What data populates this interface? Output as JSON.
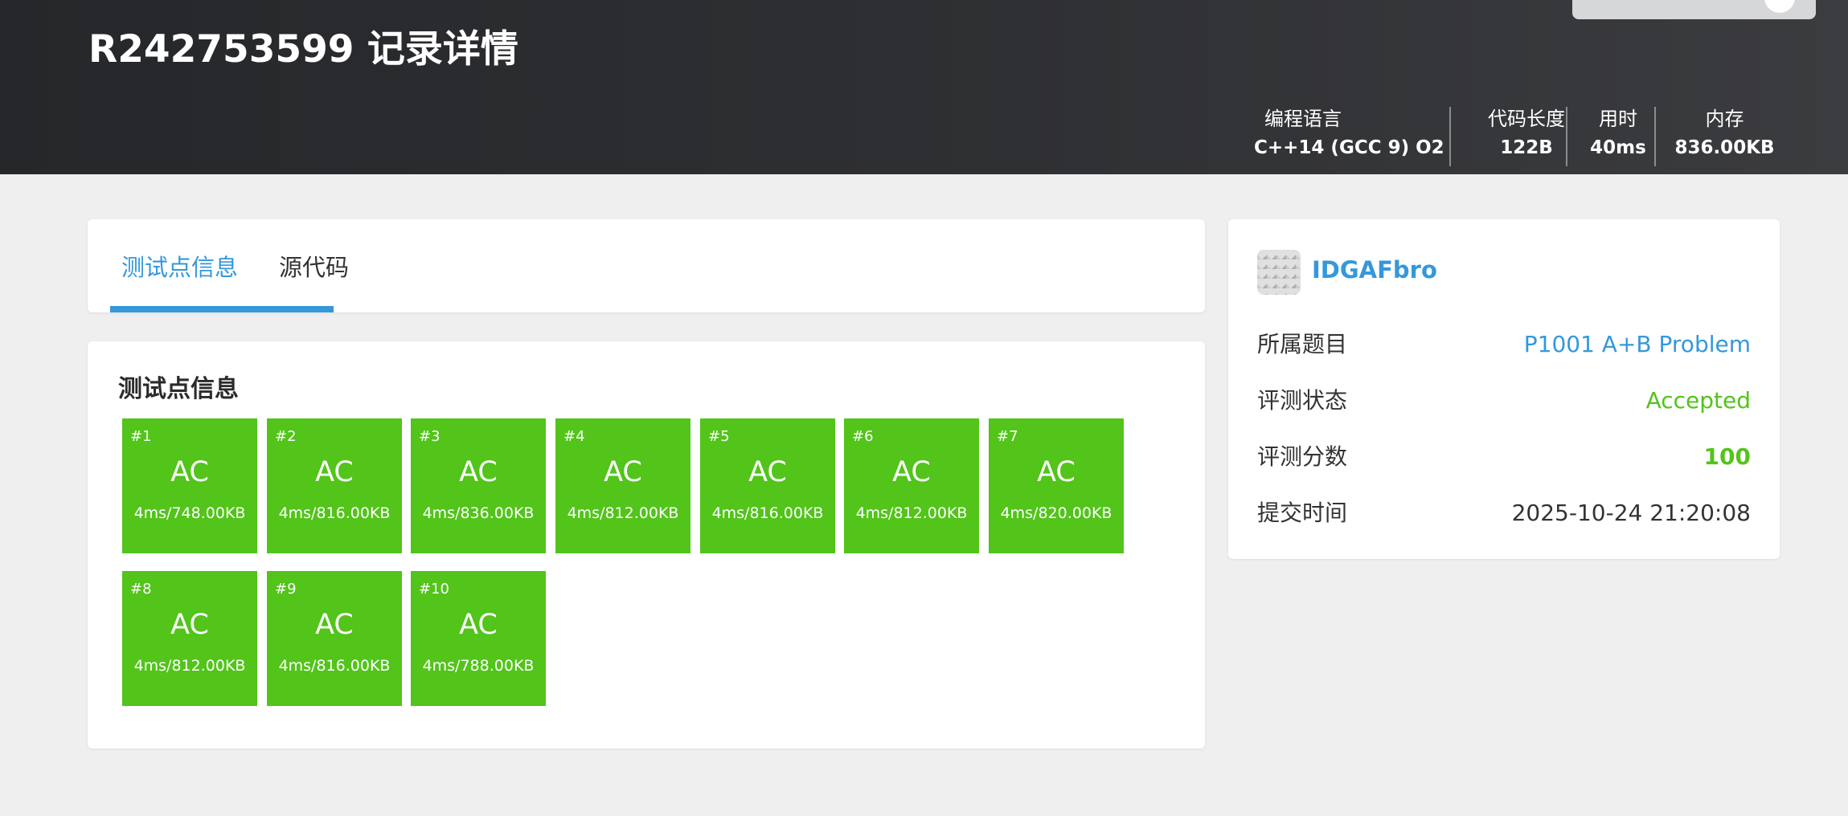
{
  "header": {
    "title": "R242753599 记录详情",
    "stats": [
      {
        "label": "编程语言",
        "value": "C++14 (GCC 9) O2"
      },
      {
        "label": "代码长度",
        "value": "122B"
      },
      {
        "label": "用时",
        "value": "40ms"
      },
      {
        "label": "内存",
        "value": "836.00KB"
      }
    ]
  },
  "tabs": [
    {
      "label": "测试点信息",
      "active": true
    },
    {
      "label": "源代码",
      "active": false
    }
  ],
  "tests": {
    "title": "测试点信息",
    "color": "#52c41a",
    "cases": [
      {
        "id": "#1",
        "status": "AC",
        "detail": "4ms/748.00KB"
      },
      {
        "id": "#2",
        "status": "AC",
        "detail": "4ms/816.00KB"
      },
      {
        "id": "#3",
        "status": "AC",
        "detail": "4ms/836.00KB"
      },
      {
        "id": "#4",
        "status": "AC",
        "detail": "4ms/812.00KB"
      },
      {
        "id": "#5",
        "status": "AC",
        "detail": "4ms/816.00KB"
      },
      {
        "id": "#6",
        "status": "AC",
        "detail": "4ms/812.00KB"
      },
      {
        "id": "#7",
        "status": "AC",
        "detail": "4ms/820.00KB"
      },
      {
        "id": "#8",
        "status": "AC",
        "detail": "4ms/812.00KB"
      },
      {
        "id": "#9",
        "status": "AC",
        "detail": "4ms/816.00KB"
      },
      {
        "id": "#10",
        "status": "AC",
        "detail": "4ms/788.00KB"
      }
    ]
  },
  "info": {
    "username": "IDGAFbro",
    "problem_label": "所属题目",
    "problem_value": "P1001 A+B Problem",
    "status_label": "评测状态",
    "status_value": "Accepted",
    "score_label": "评测分数",
    "score_value": "100",
    "time_label": "提交时间",
    "time_value": "2025-10-24 21:20:08"
  },
  "colors": {
    "accent": "#3498db",
    "accepted": "#52c41a",
    "header_bg": "#2b2d30"
  },
  "icons": {
    "avatar": "avatar-image",
    "header_action": "user-icon"
  }
}
